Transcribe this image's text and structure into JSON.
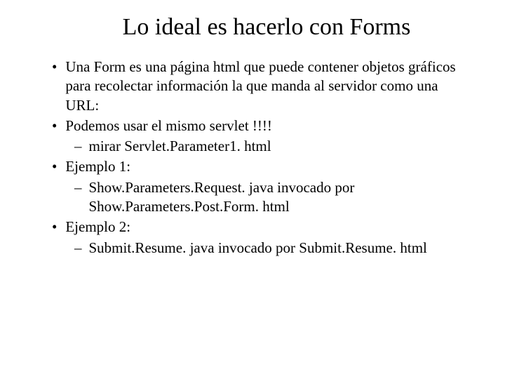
{
  "slide": {
    "title": "Lo ideal es hacerlo con Forms",
    "bullets": [
      {
        "text": "Una Form es una página html que puede contener objetos gráficos para recolectar información la que manda al servidor como una URL:",
        "subs": []
      },
      {
        "text": "Podemos usar el mismo servlet !!!!",
        "subs": [
          "mirar Servlet.Parameter1. html"
        ]
      },
      {
        "text": "Ejemplo 1:",
        "subs": [
          "Show.Parameters.Request. java invocado por Show.Parameters.Post.Form. html"
        ]
      },
      {
        "text": "Ejemplo 2:",
        "subs": [
          "Submit.Resume. java invocado por Submit.Resume. html"
        ]
      }
    ]
  },
  "markers": {
    "bullet": "•",
    "sub": "–"
  }
}
